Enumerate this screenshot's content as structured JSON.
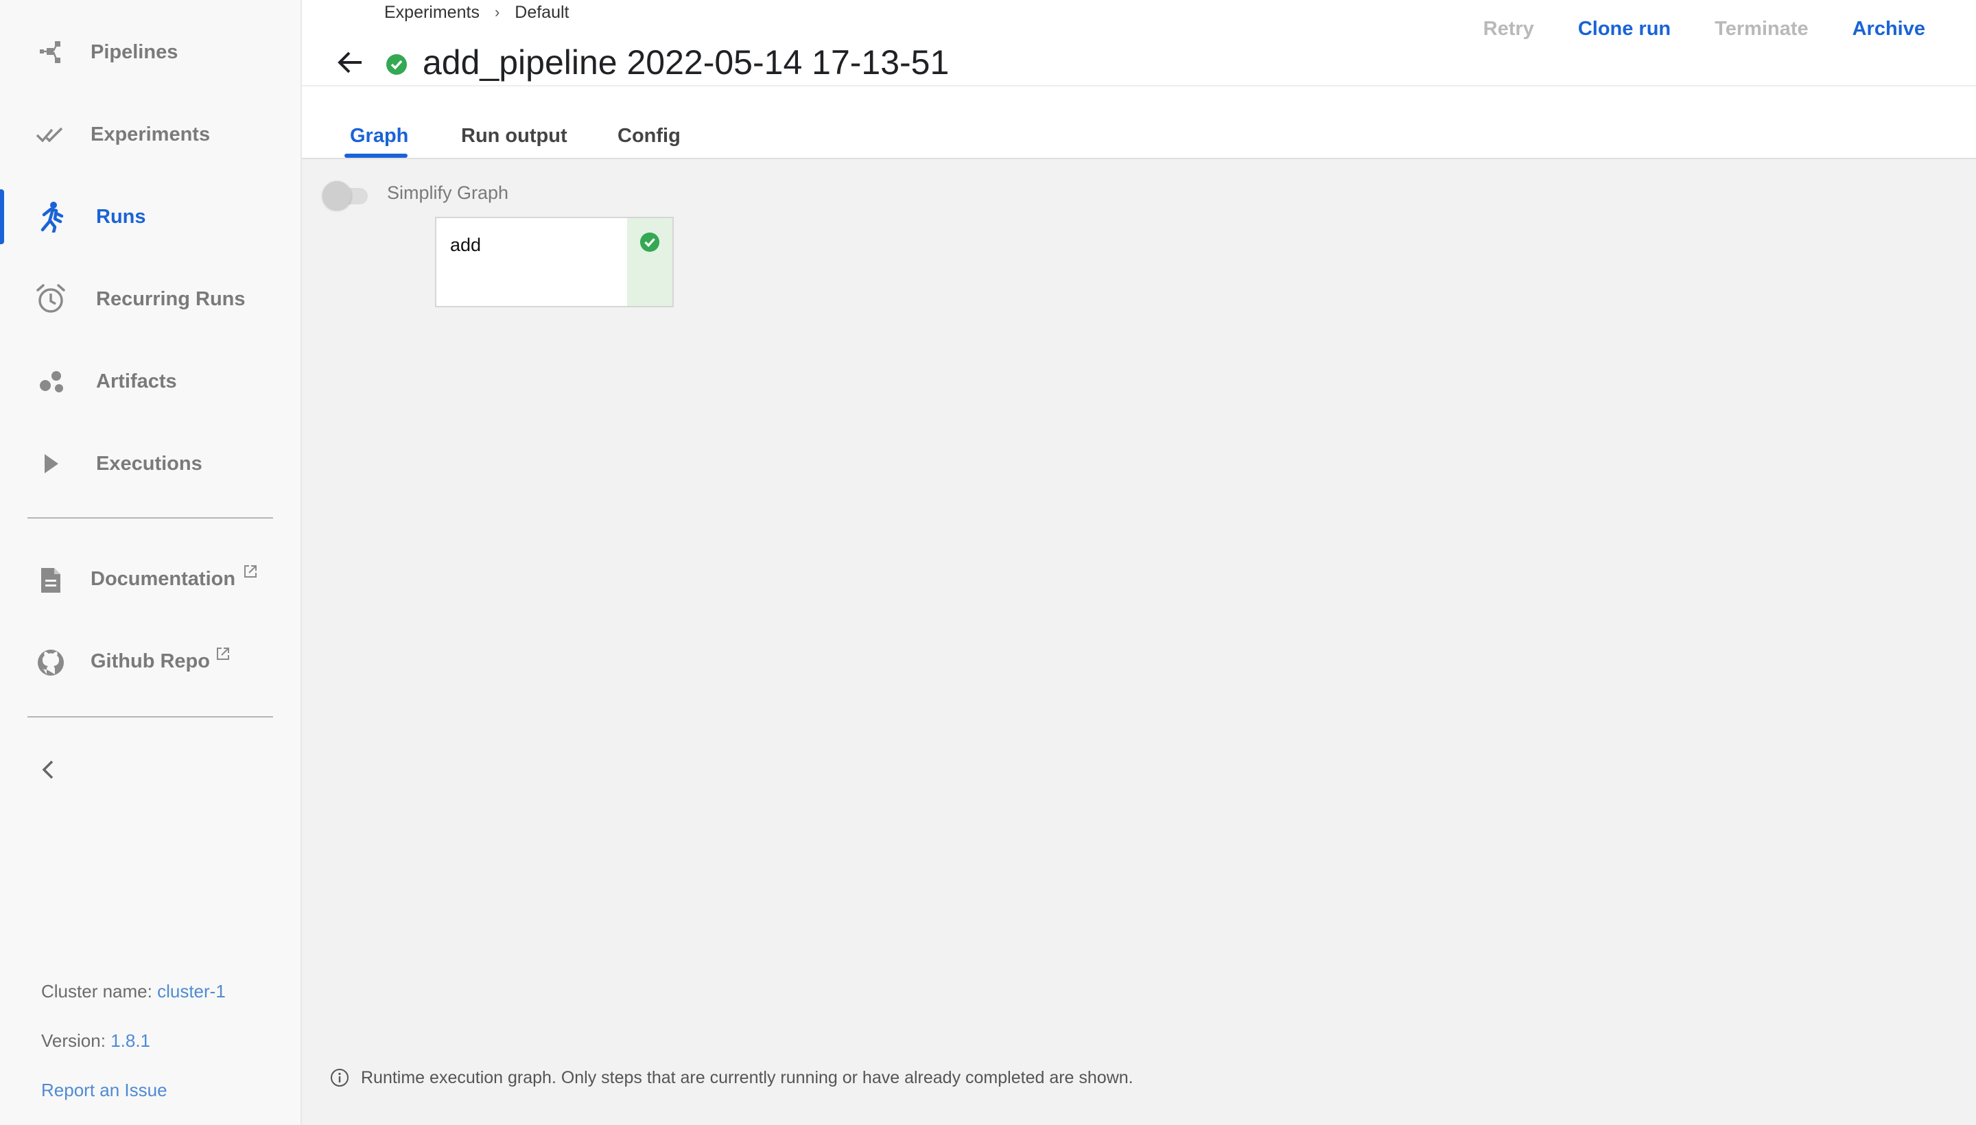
{
  "sidebar": {
    "items": [
      {
        "label": "Pipelines",
        "icon": "pipelines-icon",
        "active": false
      },
      {
        "label": "Experiments",
        "icon": "experiments-icon",
        "active": false
      },
      {
        "label": "Runs",
        "icon": "runs-icon",
        "active": true
      },
      {
        "label": "Recurring Runs",
        "icon": "alarm-clock-icon",
        "active": false
      },
      {
        "label": "Artifacts",
        "icon": "artifacts-icon",
        "active": false
      },
      {
        "label": "Executions",
        "icon": "play-icon",
        "active": false
      }
    ],
    "links": [
      {
        "label": "Documentation",
        "icon": "document-icon",
        "external": true
      },
      {
        "label": "Github Repo",
        "icon": "github-icon",
        "external": true
      }
    ],
    "footer": {
      "cluster_label": "Cluster name:",
      "cluster_value": "cluster-1",
      "version_label": "Version:",
      "version_value": "1.8.1",
      "report_label": "Report an Issue"
    }
  },
  "header": {
    "breadcrumb": [
      "Experiments",
      "Default"
    ],
    "title": "add_pipeline 2022-05-14 17-13-51",
    "status": "succeeded",
    "actions": [
      {
        "label": "Retry",
        "enabled": false
      },
      {
        "label": "Clone run",
        "enabled": true
      },
      {
        "label": "Terminate",
        "enabled": false
      },
      {
        "label": "Archive",
        "enabled": true
      }
    ]
  },
  "tabs": [
    {
      "label": "Graph",
      "active": true
    },
    {
      "label": "Run output",
      "active": false
    },
    {
      "label": "Config",
      "active": false
    }
  ],
  "graph": {
    "simplify_label": "Simplify Graph",
    "simplify_on": false,
    "nodes": [
      {
        "label": "add",
        "status": "succeeded"
      }
    ],
    "info_text": "Runtime execution graph. Only steps that are currently running or have already completed are shown."
  },
  "colors": {
    "accent": "#1a63d6",
    "success": "#34a853",
    "success_bg": "#e3f2e2",
    "disabled": "#b9b9b9",
    "canvas_bg": "#f2f2f2"
  }
}
